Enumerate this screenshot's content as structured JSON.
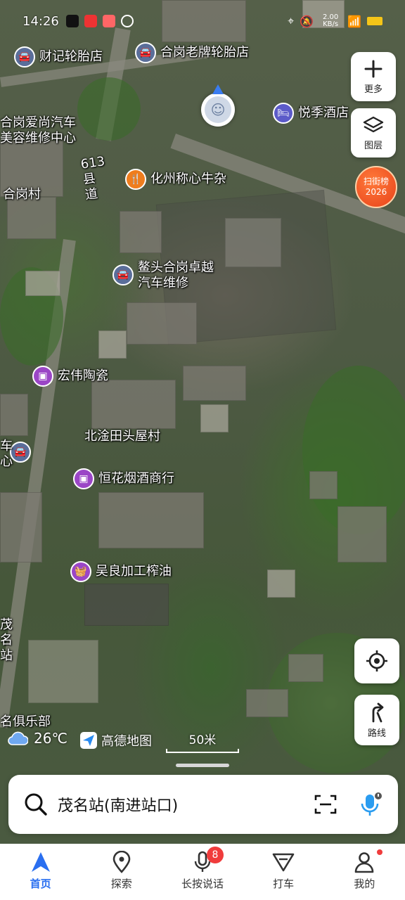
{
  "status_bar": {
    "time": "14:26",
    "net_speed": "2.00 KB/s"
  },
  "map": {
    "pois": [
      {
        "label": "财记轮胎店",
        "icon": "car-repair-icon"
      },
      {
        "label": "合岗老牌轮胎店",
        "icon": "car-repair-icon"
      },
      {
        "label": "悦季酒店",
        "icon": "hotel-icon"
      },
      {
        "label": "化州称心牛杂",
        "icon": "restaurant-icon"
      },
      {
        "label": "鳌头合岗卓越汽车维修",
        "icon": "car-repair-icon"
      },
      {
        "label": "宏伟陶瓷",
        "icon": "shop-icon"
      },
      {
        "label": "恒花烟酒商行",
        "icon": "shop-icon"
      },
      {
        "label": "吴良加工榨油",
        "icon": "shopping-basket-icon"
      },
      {
        "label": "",
        "icon": "car-repair-icon"
      }
    ],
    "labels": {
      "aishang": "合岗爱尚汽车美容维修中心",
      "village": "合岗村",
      "road": "613县道",
      "beitu": "北淦田头屋村",
      "maoming": "茂名站",
      "club": "名俱乐部",
      "edge_left": "车心"
    },
    "side_buttons": {
      "more": "更多",
      "layers": "图层",
      "route": "路线"
    },
    "promo_badge": {
      "line1": "扫街榜",
      "line2": "2026"
    },
    "weather": {
      "temp": "26℃",
      "icon": "cloud-icon"
    },
    "brand": "高德地图",
    "scale": "50米"
  },
  "search": {
    "query": "茂名站(南进站口)"
  },
  "bottom_nav": {
    "items": [
      {
        "label": "首页",
        "icon": "navigation-arrow-icon",
        "active": true
      },
      {
        "label": "探索",
        "icon": "location-pin-icon"
      },
      {
        "label": "长按说话",
        "icon": "microphone-icon",
        "badge": "8"
      },
      {
        "label": "打车",
        "icon": "taxi-icon"
      },
      {
        "label": "我的",
        "icon": "user-icon"
      }
    ]
  },
  "colors": {
    "accent": "#2a6ff0",
    "badge_red": "#f03c3c",
    "promo_orange": "#e8421a"
  }
}
